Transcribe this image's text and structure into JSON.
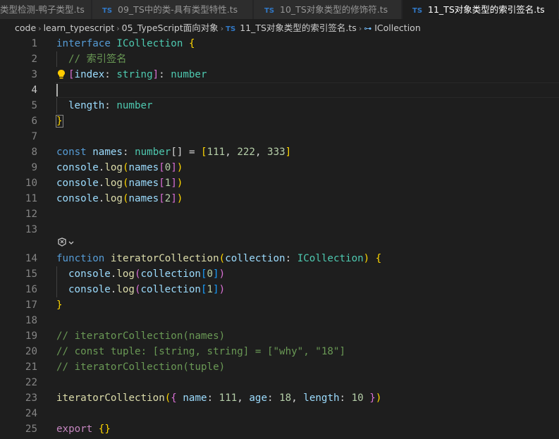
{
  "tabs": [
    {
      "label": "类型检测-鸭子类型.ts",
      "icon": "",
      "active": false
    },
    {
      "label": "09_TS中的类-具有类型特性.ts",
      "icon": "TS",
      "active": false
    },
    {
      "label": "10_TS对象类型的修饰符.ts",
      "icon": "TS",
      "active": false
    },
    {
      "label": "11_TS对象类型的索引签名.ts",
      "icon": "TS",
      "active": true
    }
  ],
  "breadcrumb": {
    "items": [
      "code",
      "learn_typescript",
      "05_TypeScript面向对象"
    ],
    "file_icon": "TS",
    "file": "11_TS对象类型的索引签名.ts",
    "symbol_icon": "interface-symbol-icon",
    "symbol": "ICollection"
  },
  "editor": {
    "current_line": 4,
    "line_numbers": [
      "1",
      "2",
      "3",
      "4",
      "5",
      "6",
      "7",
      "8",
      "9",
      "10",
      "11",
      "12",
      "13",
      "14",
      "15",
      "16",
      "17",
      "18",
      "19",
      "20",
      "21",
      "22",
      "23",
      "24",
      "25"
    ],
    "code": {
      "l1_kw": "interface",
      "l1_name": "ICollection",
      "l1_brace": "{",
      "l2_comment": "// 索引签名",
      "l3_open": "[",
      "l3_index": "index",
      "l3_colon": ": ",
      "l3_string": "string",
      "l3_close": "]",
      "l3_colon2": ": ",
      "l3_number": "number",
      "l5_length": "length",
      "l5_colon": ": ",
      "l5_number": "number",
      "l6_brace": "}",
      "l8_const": "const",
      "l8_names": "names",
      "l8_colon": ": ",
      "l8_type": "number",
      "l8_arr": "[]",
      "l8_eq": " = ",
      "l8_open": "[",
      "l8_n1": "111",
      "l8_n2": "222",
      "l8_n3": "333",
      "l8_comma": ", ",
      "l8_close": "]",
      "console": "console",
      "dot": ".",
      "log": "log",
      "paren_open": "(",
      "paren_close": ")",
      "names": "names",
      "sq_open": "[",
      "sq_close": "]",
      "idx0": "0",
      "idx1": "1",
      "idx2": "2",
      "l14_function": "function",
      "l14_name": "iteratorCollection",
      "l14_param": "collection",
      "l14_colon": ": ",
      "l14_type": "ICollection",
      "l14_brace": "{",
      "l15_collection": "collection",
      "l17_brace": "}",
      "l19_comment": "// iteratorCollection(names)",
      "l20_comment": "// const tuple: [string, string] = [\"why\", \"18\"]",
      "l21_comment": "// iteratorCollection(tuple)",
      "l23_fn": "iteratorCollection",
      "l23_obj_open": "{",
      "l23_name": "name",
      "l23_name_val": "111",
      "l23_age": "age",
      "l23_age_val": "18",
      "l23_length": "length",
      "l23_length_val": "10",
      "l23_obj_close": "}",
      "colon_sp": ": ",
      "comma_sp": ", ",
      "space": " ",
      "l25_export": "export",
      "l25_braces": "{}"
    }
  },
  "colors": {
    "background": "#1e1e1e",
    "keyword": "#569cd6",
    "type": "#4ec9b0",
    "variable": "#9cdcfe",
    "function": "#dcdcaa",
    "number": "#b5cea8",
    "comment": "#6a9955",
    "bracket_gold": "#ffd700",
    "bracket_purple": "#da70d6",
    "bracket_blue": "#179fff"
  }
}
